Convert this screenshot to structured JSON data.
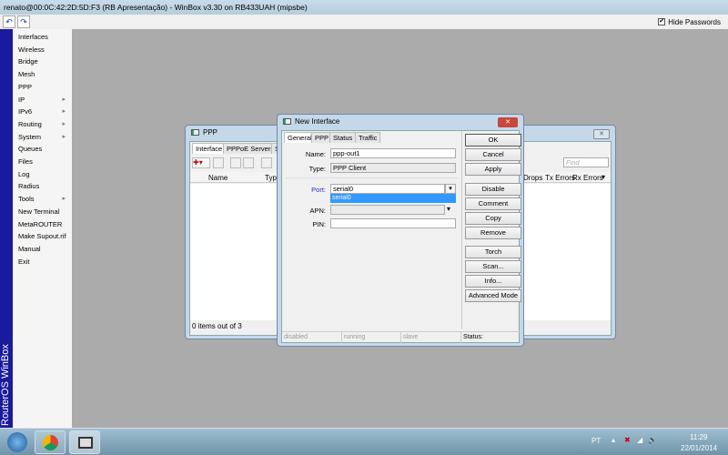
{
  "window": {
    "title": "renato@00:0C:42:2D:5D:F3 (RB Apresentação) - WinBox v3.30 on RB433UAH (mipsbe)",
    "hide_passwords": "Hide Passwords",
    "hide_checked": "✔",
    "undo": "↶",
    "redo": "↷"
  },
  "sidebar": {
    "brand": "RouterOS WinBox",
    "items": [
      {
        "label": "Interfaces",
        "sub": ""
      },
      {
        "label": "Wireless",
        "sub": ""
      },
      {
        "label": "Bridge",
        "sub": ""
      },
      {
        "label": "Mesh",
        "sub": ""
      },
      {
        "label": "PPP",
        "sub": ""
      },
      {
        "label": "IP",
        "sub": "▸"
      },
      {
        "label": "IPv6",
        "sub": "▸"
      },
      {
        "label": "Routing",
        "sub": "▸"
      },
      {
        "label": "System",
        "sub": "▸"
      },
      {
        "label": "Queues",
        "sub": ""
      },
      {
        "label": "Files",
        "sub": ""
      },
      {
        "label": "Log",
        "sub": ""
      },
      {
        "label": "Radius",
        "sub": ""
      },
      {
        "label": "Tools",
        "sub": "▸"
      },
      {
        "label": "New Terminal",
        "sub": ""
      },
      {
        "label": "MetaROUTER",
        "sub": ""
      },
      {
        "label": "Make Supout.rif",
        "sub": ""
      },
      {
        "label": "Manual",
        "sub": ""
      },
      {
        "label": "Exit",
        "sub": ""
      }
    ]
  },
  "ppp": {
    "title": "PPP",
    "tabs": [
      "Interface",
      "PPPoE Servers",
      "S"
    ],
    "columns": [
      "Name",
      "Typ",
      "Drops",
      "Tx Errors",
      "Rx Errors"
    ],
    "find_placeholder": "Find",
    "status": "0 items out of 3",
    "add": "✚▾",
    "close": "✕"
  },
  "dialog": {
    "title": "New Interface",
    "close": "✕",
    "tabs": [
      "General",
      "PPP",
      "Status",
      "Traffic"
    ],
    "fields": {
      "name_label": "Name:",
      "name": "ppp-out1",
      "type_label": "Type:",
      "type": "PPP Client",
      "port_label": "Port:",
      "port": "serial0",
      "port_option": "serial0",
      "apn_label": "APN:",
      "apn": "",
      "pin_label": "PIN:",
      "pin": ""
    },
    "buttons": [
      "OK",
      "Cancel",
      "Apply",
      "Disable",
      "Comment",
      "Copy",
      "Remove",
      "Torch",
      "Scan...",
      "Info...",
      "Advanced Mode"
    ],
    "status": [
      "disabled",
      "running",
      "slave",
      "Status:"
    ]
  },
  "taskbar": {
    "lang": "PT",
    "time": "11:29",
    "date": "22/01/2014"
  }
}
